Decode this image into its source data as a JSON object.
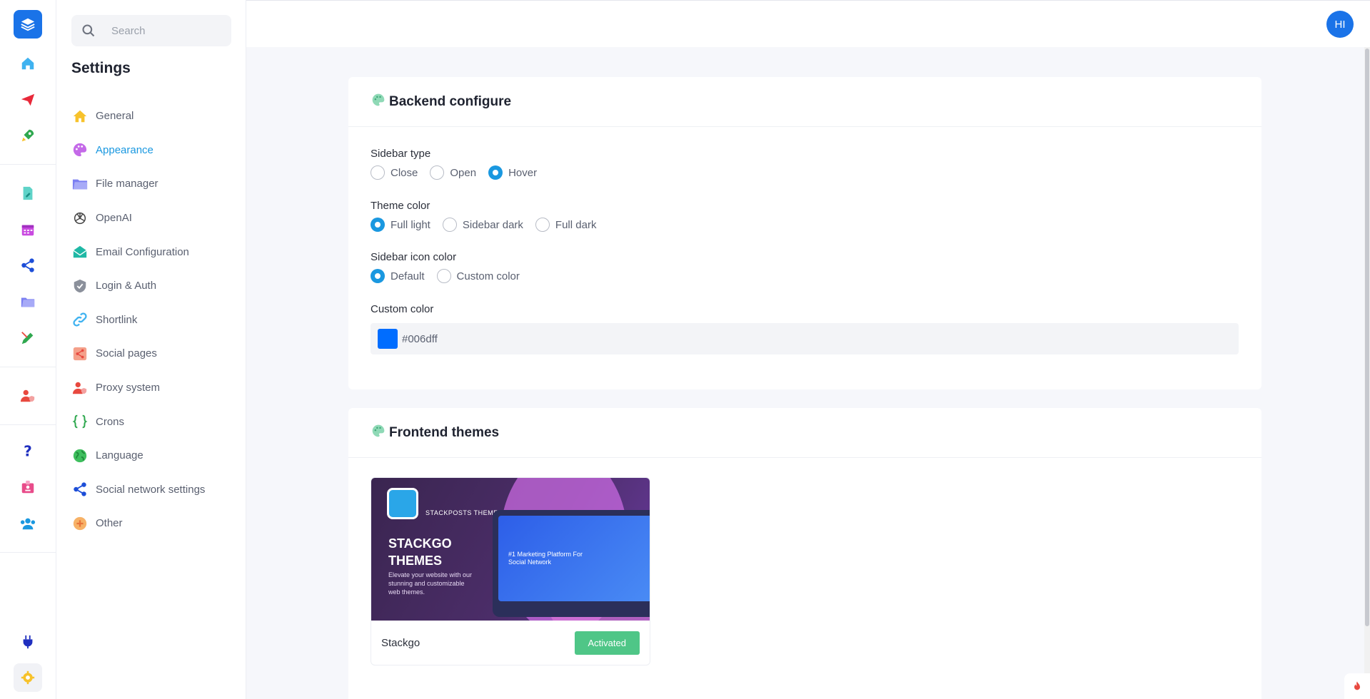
{
  "rail": {
    "icons": [
      "layers-icon",
      "home-icon",
      "send-icon",
      "rocket-icon",
      "document-edit-icon",
      "calendar-icon",
      "share-nodes-icon",
      "folder-icon",
      "pencil-icon",
      "user-shield-icon",
      "help-icon",
      "badge-icon",
      "users-icon",
      "plug-icon",
      "gear-icon"
    ]
  },
  "search": {
    "placeholder": "Search"
  },
  "sidebar": {
    "title": "Settings",
    "items": [
      {
        "label": "General",
        "icon": "home-icon",
        "color": "#f7c22b"
      },
      {
        "label": "Appearance",
        "icon": "palette-icon",
        "color": "#c46ae8",
        "active": true
      },
      {
        "label": "File manager",
        "icon": "folder-icon",
        "color": "#7b7ff2"
      },
      {
        "label": "OpenAI",
        "icon": "openai-icon",
        "color": "#444444"
      },
      {
        "label": "Email Configuration",
        "icon": "envelope-open-icon",
        "color": "#1fb8a5"
      },
      {
        "label": "Login & Auth",
        "icon": "shield-check-icon",
        "color": "#6f7480"
      },
      {
        "label": "Shortlink",
        "icon": "link-icon",
        "color": "#3fb2f0"
      },
      {
        "label": "Social pages",
        "icon": "share-square-icon",
        "color": "#f07d5e"
      },
      {
        "label": "Proxy system",
        "icon": "user-shield-icon",
        "color": "#e8493f"
      },
      {
        "label": "Crons",
        "icon": "braces-icon",
        "color": "#2fa84f"
      },
      {
        "label": "Language",
        "icon": "globe-icon",
        "color": "#3fbf5e"
      },
      {
        "label": "Social network settings",
        "icon": "share-nodes-icon",
        "color": "#1d4ed8"
      },
      {
        "label": "Other",
        "icon": "plus-circle-icon",
        "color": "#f59a3d"
      }
    ]
  },
  "topbar": {
    "avatar_initials": "HI",
    "avatar_color": "#1a73e8"
  },
  "backend": {
    "title": "Backend configure",
    "sidebar_type": {
      "label": "Sidebar type",
      "options": [
        "Close",
        "Open",
        "Hover"
      ],
      "selected": "Hover"
    },
    "theme_color": {
      "label": "Theme color",
      "options": [
        "Full light",
        "Sidebar dark",
        "Full dark"
      ],
      "selected": "Full light"
    },
    "icon_color": {
      "label": "Sidebar icon color",
      "options": [
        "Default",
        "Custom color"
      ],
      "selected": "Default"
    },
    "custom_color": {
      "label": "Custom color",
      "value": "#006dff"
    }
  },
  "frontend": {
    "title": "Frontend themes",
    "themes": [
      {
        "name": "Stackgo",
        "status": "Activated",
        "thumbnail": {
          "brand": "STACKPOSTS THEMES",
          "heading_line1": "STACKGO",
          "heading_line2": "THEMES",
          "description": "Elevate your website with our stunning and customizable web themes.",
          "screen_text": "#1 Marketing Platform For Social Network"
        }
      }
    ]
  },
  "colors": {
    "accent": "#1a98e0",
    "success": "#4fc687",
    "primary": "#1a73e8"
  }
}
